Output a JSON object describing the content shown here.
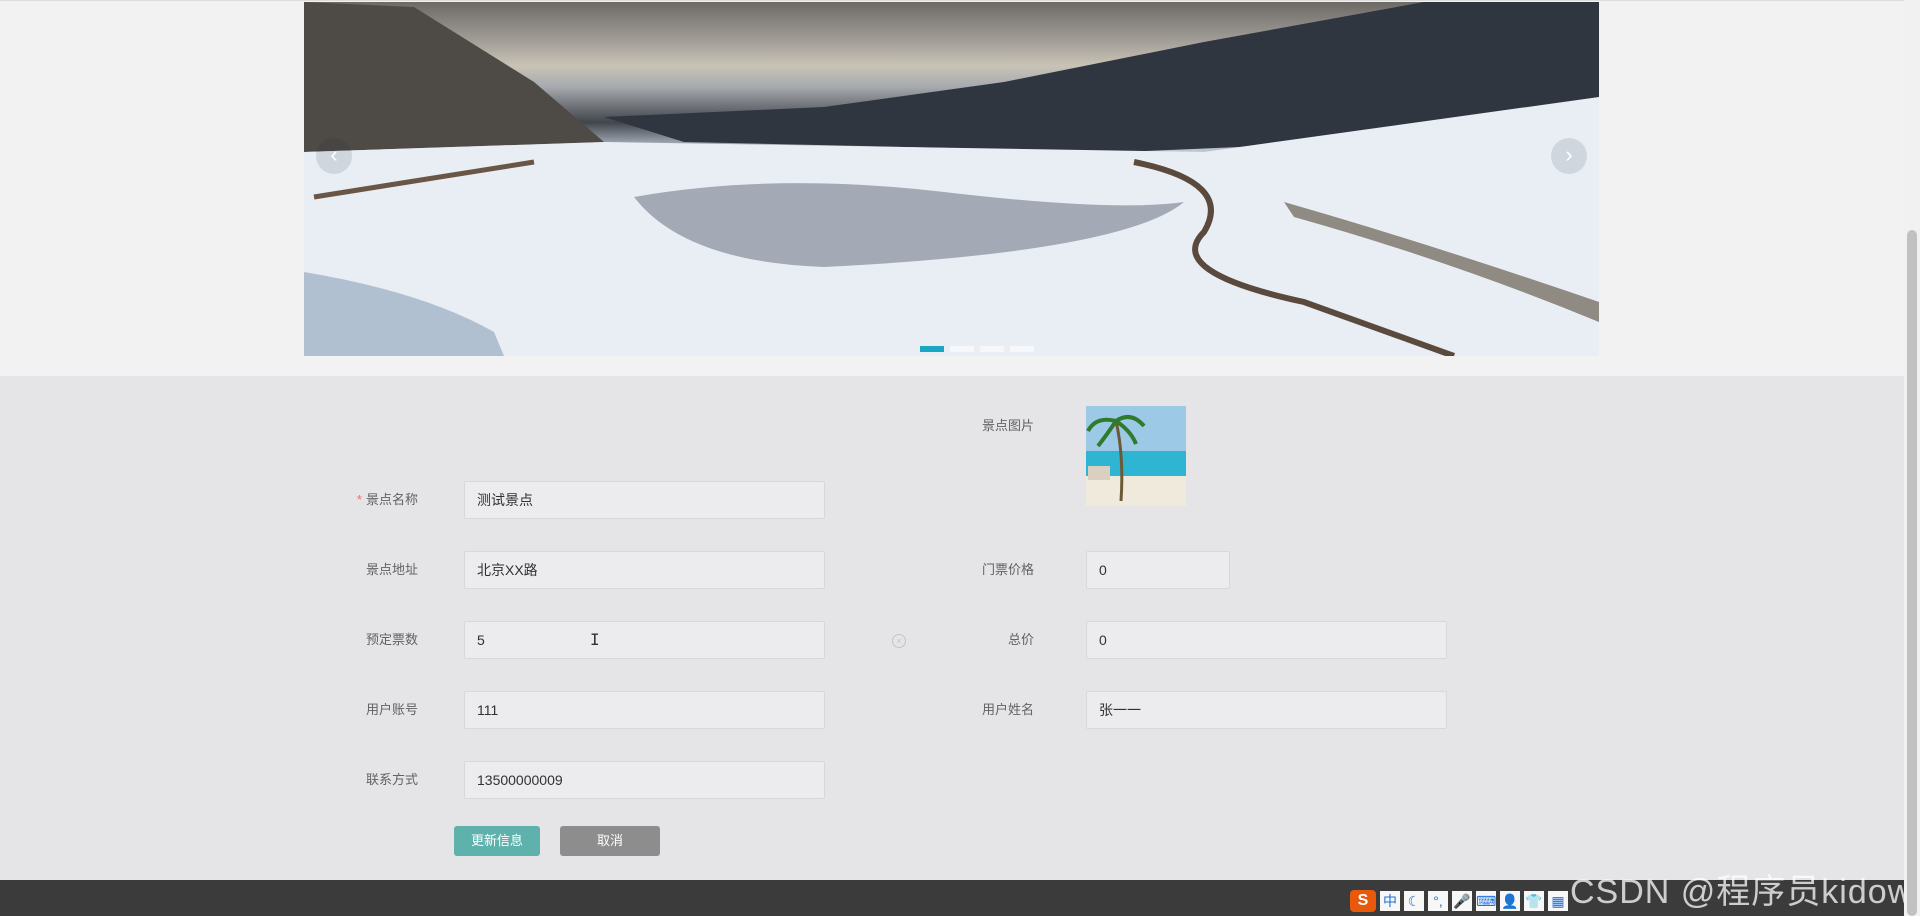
{
  "banner": {
    "prev_glyph": "‹",
    "next_glyph": "›",
    "slide_count": 4,
    "active_slide": 1
  },
  "form": {
    "required_mark": "*",
    "fields": {
      "scenic_name": {
        "label": "景点名称",
        "value": "测试景点"
      },
      "scenic_image": {
        "label": "景点图片"
      },
      "scenic_address": {
        "label": "景点地址",
        "value": "北京XX路"
      },
      "ticket_price": {
        "label": "门票价格",
        "value": "0"
      },
      "ticket_count": {
        "label": "预定票数",
        "value": "5"
      },
      "total_price": {
        "label": "总价",
        "value": "0"
      },
      "user_account": {
        "label": "用户账号",
        "value": "111"
      },
      "user_name": {
        "label": "用户姓名",
        "value": "张一一"
      },
      "contact": {
        "label": "联系方式",
        "value": "13500000009"
      }
    },
    "buttons": {
      "update_label": "更新信息",
      "cancel_label": "取消"
    }
  },
  "ime_toolbar": {
    "brand_glyph": "S",
    "mode_label": "中"
  },
  "watermark": {
    "text": "CSDN @程序员kidow"
  },
  "colors": {
    "primary": "#5fb1ac",
    "cancel": "#8d8d8d",
    "indicator_active": "#19a7c3",
    "required": "#f56c6c"
  }
}
